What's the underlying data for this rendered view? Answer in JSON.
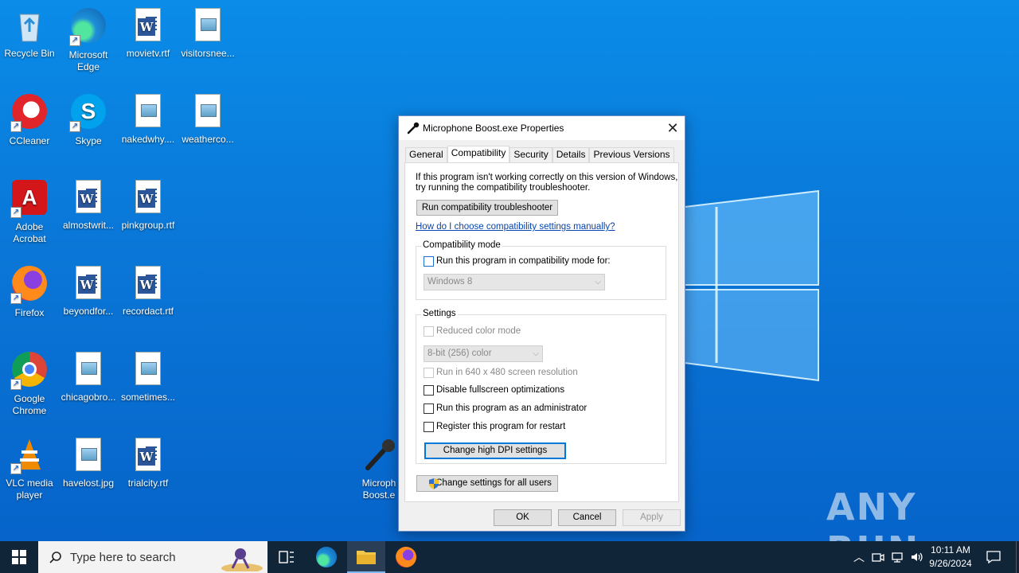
{
  "desktop": {
    "icons": [
      {
        "label": "Recycle Bin",
        "icon": "recycle-bin-icon"
      },
      {
        "label": "Microsoft Edge",
        "icon": "edge-icon"
      },
      {
        "label": "movietv.rtf",
        "icon": "word-document-icon"
      },
      {
        "label": "visitorsnee...",
        "icon": "image-file-icon"
      },
      {
        "label": "CCleaner",
        "icon": "ccleaner-icon"
      },
      {
        "label": "Skype",
        "icon": "skype-icon"
      },
      {
        "label": "nakedwhy....",
        "icon": "image-file-icon"
      },
      {
        "label": "weatherco...",
        "icon": "image-file-icon"
      },
      {
        "label": "Adobe Acrobat",
        "icon": "acrobat-icon"
      },
      {
        "label": "almostwrit...",
        "icon": "word-document-icon"
      },
      {
        "label": "pinkgroup.rtf",
        "icon": "word-document-icon"
      },
      {
        "label": "Firefox",
        "icon": "firefox-icon"
      },
      {
        "label": "beyondfor...",
        "icon": "word-document-icon"
      },
      {
        "label": "recordact.rtf",
        "icon": "word-document-icon"
      },
      {
        "label": "Google Chrome",
        "icon": "chrome-icon"
      },
      {
        "label": "chicagobro...",
        "icon": "image-file-icon"
      },
      {
        "label": "sometimes...",
        "icon": "image-file-icon"
      },
      {
        "label": "VLC media player",
        "icon": "vlc-icon"
      },
      {
        "label": "havelost.jpg",
        "icon": "image-file-icon"
      },
      {
        "label": "trialcity.rtf",
        "icon": "word-document-icon"
      },
      {
        "label": "Microphone Boost.exe",
        "icon": "microphone-icon"
      }
    ],
    "partial_icon_label_line1": "Microph",
    "partial_icon_label_line2": "Boost.e",
    "watermark": "ANY RUN"
  },
  "dialog": {
    "title": "Microphone Boost.exe Properties",
    "tabs": [
      "General",
      "Compatibility",
      "Security",
      "Details",
      "Previous Versions"
    ],
    "active_tab": "Compatibility",
    "intro_line1": "If this program isn't working correctly on this version of Windows,",
    "intro_line2": "try running the compatibility troubleshooter.",
    "run_troubleshooter": "Run compatibility troubleshooter",
    "manual_link": "How do I choose compatibility settings manually?",
    "compat_mode": {
      "group_label": "Compatibility mode",
      "checkbox_label": "Run this program in compatibility mode for:",
      "checked": false,
      "select_value": "Windows 8"
    },
    "settings": {
      "group_label": "Settings",
      "reduced_color": "Reduced color mode",
      "color_select": "8-bit (256) color",
      "run_640": "Run in 640 x 480 screen resolution",
      "disable_fullscreen": "Disable fullscreen optimizations",
      "run_admin": "Run this program as an administrator",
      "register_restart": "Register this program for restart",
      "dpi_button": "Change high DPI settings"
    },
    "all_users_button": "Change settings for all users",
    "ok": "OK",
    "cancel": "Cancel",
    "apply": "Apply"
  },
  "taskbar": {
    "search_placeholder": "Type here to search",
    "time": "10:11 AM",
    "date": "9/26/2024"
  }
}
